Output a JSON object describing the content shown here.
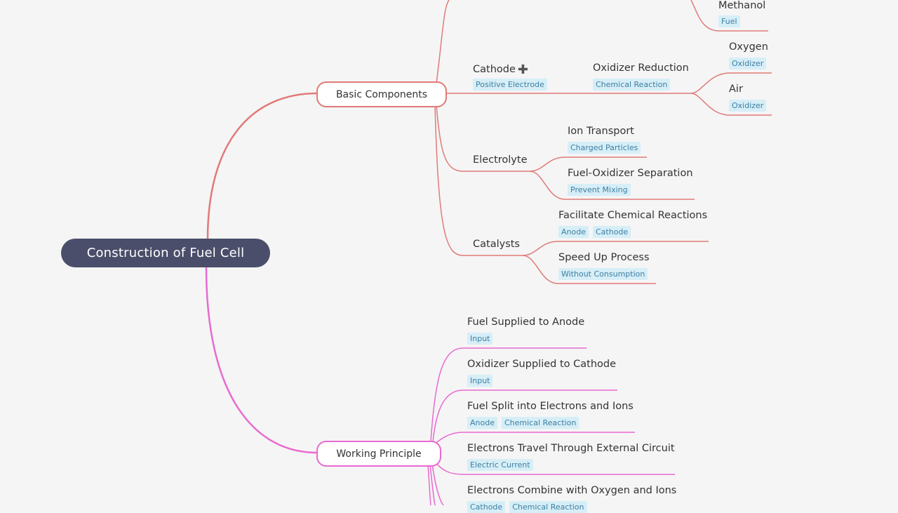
{
  "colors": {
    "root_bg": "#4a4e6a",
    "branch_basic": "#e07b78",
    "branch_working": "#e86ad0",
    "tag_bg": "#d6eef7",
    "tag_text": "#3e7fa2",
    "background": "#f5f5f5"
  },
  "root": {
    "label": "Construction of Fuel Cell"
  },
  "basic_components": {
    "label": "Basic Components",
    "children": {
      "methanol": {
        "label": "Methanol",
        "tags": [
          "Fuel"
        ]
      },
      "cathode": {
        "label": "Cathode",
        "icon": "plus-icon",
        "tags": [
          "Positive Electrode"
        ],
        "child": {
          "label": "Oxidizer Reduction",
          "tags": [
            "Chemical Reaction"
          ],
          "children": [
            {
              "label": "Oxygen",
              "tags": [
                "Oxidizer"
              ]
            },
            {
              "label": "Air",
              "tags": [
                "Oxidizer"
              ]
            }
          ]
        }
      },
      "electrolyte": {
        "label": "Electrolyte",
        "children": [
          {
            "label": "Ion Transport",
            "tags": [
              "Charged Particles"
            ]
          },
          {
            "label": "Fuel-Oxidizer Separation",
            "tags": [
              "Prevent Mixing"
            ]
          }
        ]
      },
      "catalysts": {
        "label": "Catalysts",
        "children": [
          {
            "label": "Facilitate Chemical Reactions",
            "tags": [
              "Anode",
              "Cathode"
            ]
          },
          {
            "label": "Speed Up Process",
            "tags": [
              "Without Consumption"
            ]
          }
        ]
      }
    }
  },
  "working_principle": {
    "label": "Working Principle",
    "children": [
      {
        "label": "Fuel Supplied to Anode",
        "tags": [
          "Input"
        ]
      },
      {
        "label": "Oxidizer Supplied to Cathode",
        "tags": [
          "Input"
        ]
      },
      {
        "label": "Fuel Split into Electrons and Ions",
        "tags": [
          "Anode",
          "Chemical Reaction"
        ]
      },
      {
        "label": "Electrons Travel Through External Circuit",
        "tags": [
          "Electric Current"
        ]
      },
      {
        "label": "Electrons Combine with Oxygen and Ions",
        "tags": [
          "Cathode",
          "Chemical Reaction"
        ]
      }
    ]
  }
}
